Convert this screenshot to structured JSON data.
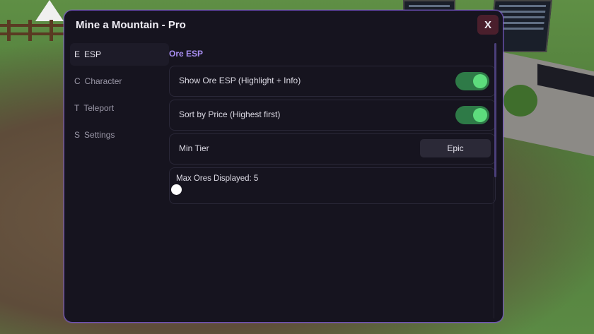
{
  "window": {
    "title": "Mine a Mountain - Pro",
    "close_label": "X",
    "accent_color": "#6d4fb8"
  },
  "sidebar": {
    "items": [
      {
        "letter": "E",
        "label": "ESP",
        "active": true
      },
      {
        "letter": "C",
        "label": "Character",
        "active": false
      },
      {
        "letter": "T",
        "label": "Teleport",
        "active": false
      },
      {
        "letter": "S",
        "label": "Settings",
        "active": false
      }
    ]
  },
  "content": {
    "section_title": "Ore ESP",
    "show_ore_esp": {
      "label": "Show Ore ESP (Highlight + Info)",
      "enabled": true
    },
    "sort_by_price": {
      "label": "Sort by Price (Highest first)",
      "enabled": true
    },
    "min_tier": {
      "label": "Min Tier",
      "value": "Epic"
    },
    "max_ores": {
      "label": "Max Ores Displayed: 5",
      "value": 5
    }
  },
  "colors": {
    "toggle_on": "#2e7a47",
    "toggle_knob": "#5ddc7d",
    "section_title": "#a88ef2"
  }
}
